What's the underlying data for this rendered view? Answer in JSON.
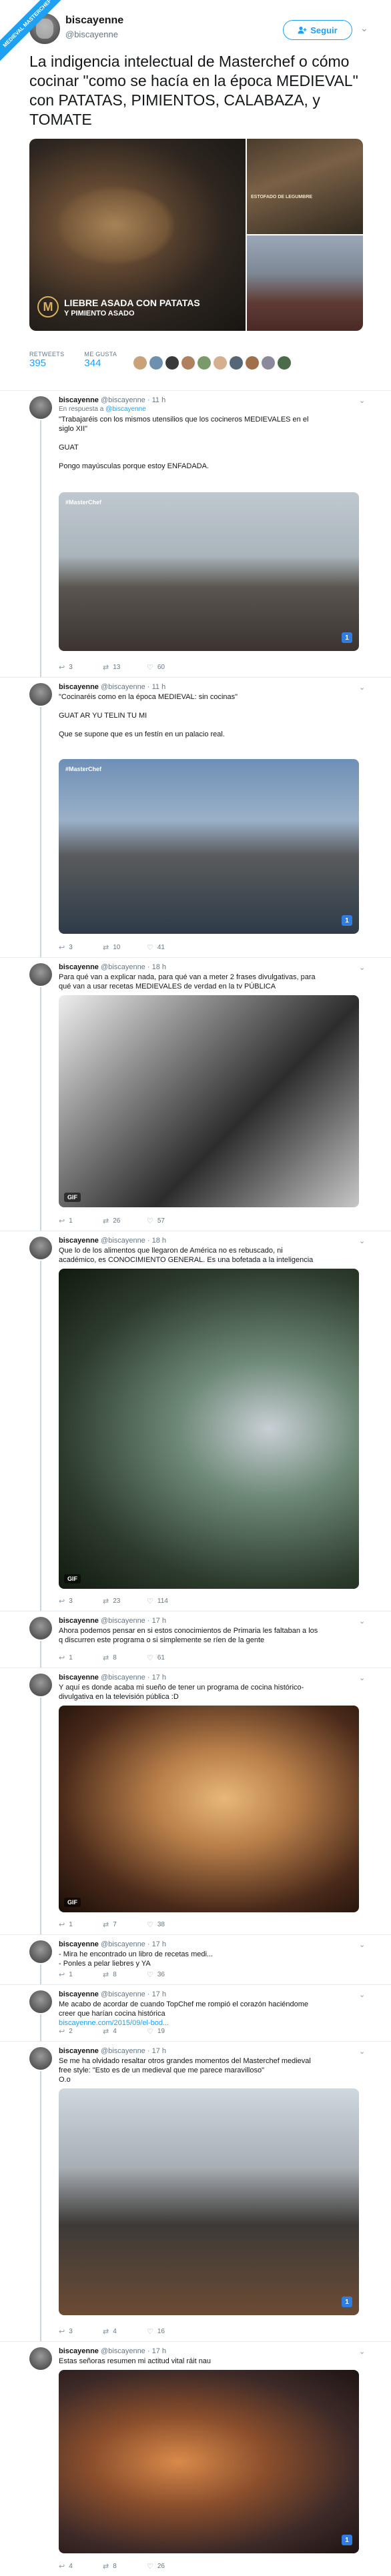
{
  "badge": "MEDIEVAL MASTERCHEF",
  "main": {
    "name": "biscayenne",
    "handle": "@biscayenne",
    "follow_label": "Seguir",
    "text": "La indigencia intelectual de Masterchef o cómo cocinar \"como se hacía en la época MEDIEVAL\" con PATATAS, PIMIENTOS, CALABAZA, y TOMATE",
    "media": {
      "caption_title": "LIEBRE ASADA CON PATATAS",
      "caption_sub": "Y PIMIENTO ASADO",
      "side_caption": "ESTOFADO DE LEGUMBRE"
    },
    "retweets_label": "RETWEETS",
    "retweets": "395",
    "likes_label": "ME GUSTA",
    "likes": "344",
    "liker_colors": [
      "#c9a27a",
      "#6d8fb0",
      "#3a3a3a",
      "#b08060",
      "#7a9a6a",
      "#d4b090",
      "#556677",
      "#a0704a",
      "#8a8a9a",
      "#4b6b4b"
    ]
  },
  "replies": [
    {
      "name": "biscayenne",
      "handle": "@biscayenne",
      "time": "· 11 h",
      "in_reply_label": "En respuesta a",
      "in_reply_handle": "@biscayenne",
      "lines": [
        "\"Trabajaréis con los mismos utensilios que los cocineros MEDIEVALES en el",
        "siglo XII\"",
        "",
        "GUAT",
        "",
        "Pongo mayúsculas porque estoy ENFADADA."
      ],
      "media_tag": "#MasterChef",
      "actions": [
        "3",
        "13",
        "60"
      ]
    },
    {
      "name": "biscayenne",
      "handle": "@biscayenne",
      "time": "· 11 h",
      "lines": [
        "\"Cocinaréis como en la época MEDIEVAL: sin cocinas\"",
        "",
        "GUAT AR YU TELIN TU MI",
        "",
        "Que se supone que es un festín en un palacio real."
      ],
      "media_tag": "#MasterChef",
      "actions": [
        "3",
        "10",
        "41"
      ]
    },
    {
      "name": "biscayenne",
      "handle": "@biscayenne",
      "time": "· 18 h",
      "lines": [
        "Para qué van a explicar nada, para qué van a meter 2 frases divulgativas, para",
        "qué van a usar recetas MEDIEVALES de verdad en la tv PÚBLICA"
      ],
      "gif": "GIF",
      "actions": [
        "1",
        "26",
        "57"
      ]
    },
    {
      "name": "biscayenne",
      "handle": "@biscayenne",
      "time": "· 18 h",
      "lines": [
        "Que lo de los alimentos que llegaron de América no es rebuscado, ni",
        "académico, es CONOCIMIENTO GENERAL. Es una bofetada a la inteligencia"
      ],
      "gif": "GIF",
      "actions": [
        "3",
        "23",
        "114"
      ]
    },
    {
      "name": "biscayenne",
      "handle": "@biscayenne",
      "time": "· 17 h",
      "lines": [
        "Ahora podemos pensar en si estos conocimientos de Primaria les faltaban a los",
        "q discurren este programa o si simplemente se ríen de la gente"
      ],
      "actions": [
        "1",
        "8",
        "61"
      ]
    },
    {
      "name": "biscayenne",
      "handle": "@biscayenne",
      "time": "· 17 h",
      "lines": [
        "Y aquí es donde acaba mi sueño de tener un programa de cocina histórico-",
        "divulgativa en la televisión pública :D"
      ],
      "gif": "GIF",
      "actions": [
        "1",
        "7",
        "38"
      ]
    },
    {
      "name": "biscayenne",
      "handle": "@biscayenne",
      "time": "· 17 h",
      "lines": [
        "- Mira he encontrado un libro de recetas medi...",
        "- Ponles a pelar liebres y YA"
      ],
      "actions": [
        "1",
        "8",
        "36"
      ]
    },
    {
      "name": "biscayenne",
      "handle": "@biscayenne",
      "time": "· 17 h",
      "lines": [
        "Me acabo de acordar de cuando TopChef me rompió el corazón haciéndome",
        "creer que harían cocina histórica"
      ],
      "link": "biscayenne.com/2015/09/el-bod...",
      "actions": [
        "2",
        "4",
        "19"
      ]
    },
    {
      "name": "biscayenne",
      "handle": "@biscayenne",
      "time": "· 17 h",
      "lines": [
        "Se me ha olvidado resaltar otros grandes momentos del Masterchef medieval",
        "free style: \"Esto es de un medieval que me parece maravilloso\"",
        "O.o"
      ],
      "actions": [
        "3",
        "4",
        "16"
      ]
    },
    {
      "name": "biscayenne",
      "handle": "@biscayenne",
      "time": "· 17 h",
      "lines": [
        "Estas señoras resumen mi actitud vital ráit nau"
      ],
      "actions": [
        "4",
        "8",
        "26"
      ]
    }
  ]
}
